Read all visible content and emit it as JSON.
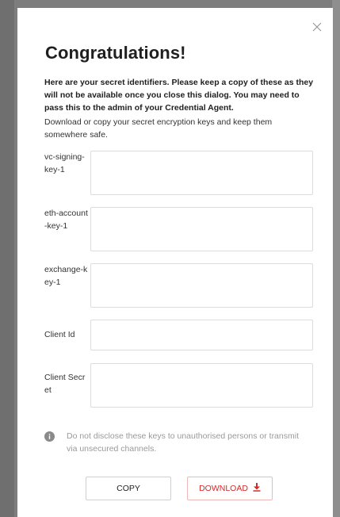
{
  "dialog": {
    "title": "Congratulations!",
    "intro_bold": "Here are your secret identifiers. Please keep a copy of these as they will not be available once you close this dialog. You may need to pass this to the admin of your Credential Agent.",
    "intro": "Download or  copy your secret encryption keys and keep them somewhere safe.",
    "close_icon": "close-icon",
    "keys": [
      {
        "label": "vc-signing-key-1",
        "value": ""
      },
      {
        "label": "eth-account-key-1",
        "value": ""
      },
      {
        "label": "exchange-key-1",
        "value": ""
      },
      {
        "label": "Client Id",
        "value": ""
      },
      {
        "label": "Client Secret",
        "value": ""
      }
    ],
    "notice": "Do not disclose these keys to unauthorised persons or transmit via unsecured channels.",
    "notice_icon": "info-icon",
    "copy_label": "COPY",
    "download_label": "DOWNLOAD",
    "download_icon": "download-icon",
    "colors": {
      "download_accent": "#d42a2a",
      "notice_text": "#9a9a9a"
    }
  }
}
